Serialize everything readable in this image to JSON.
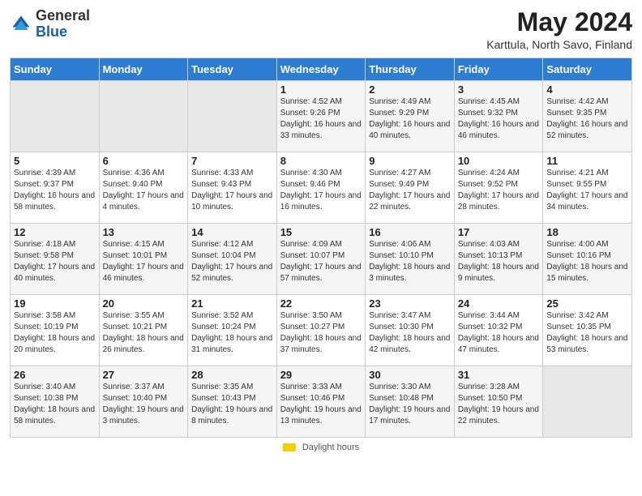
{
  "header": {
    "logo_general": "General",
    "logo_blue": "Blue",
    "month_year": "May 2024",
    "location": "Karttula, North Savo, Finland"
  },
  "weekdays": [
    "Sunday",
    "Monday",
    "Tuesday",
    "Wednesday",
    "Thursday",
    "Friday",
    "Saturday"
  ],
  "weeks": [
    [
      {
        "day": "",
        "info": ""
      },
      {
        "day": "",
        "info": ""
      },
      {
        "day": "",
        "info": ""
      },
      {
        "day": "1",
        "info": "Sunrise: 4:52 AM\nSunset: 9:26 PM\nDaylight: 16 hours\nand 33 minutes."
      },
      {
        "day": "2",
        "info": "Sunrise: 4:49 AM\nSunset: 9:29 PM\nDaylight: 16 hours\nand 40 minutes."
      },
      {
        "day": "3",
        "info": "Sunrise: 4:45 AM\nSunset: 9:32 PM\nDaylight: 16 hours\nand 46 minutes."
      },
      {
        "day": "4",
        "info": "Sunrise: 4:42 AM\nSunset: 9:35 PM\nDaylight: 16 hours\nand 52 minutes."
      }
    ],
    [
      {
        "day": "5",
        "info": "Sunrise: 4:39 AM\nSunset: 9:37 PM\nDaylight: 16 hours\nand 58 minutes."
      },
      {
        "day": "6",
        "info": "Sunrise: 4:36 AM\nSunset: 9:40 PM\nDaylight: 17 hours\nand 4 minutes."
      },
      {
        "day": "7",
        "info": "Sunrise: 4:33 AM\nSunset: 9:43 PM\nDaylight: 17 hours\nand 10 minutes."
      },
      {
        "day": "8",
        "info": "Sunrise: 4:30 AM\nSunset: 9:46 PM\nDaylight: 17 hours\nand 16 minutes."
      },
      {
        "day": "9",
        "info": "Sunrise: 4:27 AM\nSunset: 9:49 PM\nDaylight: 17 hours\nand 22 minutes."
      },
      {
        "day": "10",
        "info": "Sunrise: 4:24 AM\nSunset: 9:52 PM\nDaylight: 17 hours\nand 28 minutes."
      },
      {
        "day": "11",
        "info": "Sunrise: 4:21 AM\nSunset: 9:55 PM\nDaylight: 17 hours\nand 34 minutes."
      }
    ],
    [
      {
        "day": "12",
        "info": "Sunrise: 4:18 AM\nSunset: 9:58 PM\nDaylight: 17 hours\nand 40 minutes."
      },
      {
        "day": "13",
        "info": "Sunrise: 4:15 AM\nSunset: 10:01 PM\nDaylight: 17 hours\nand 46 minutes."
      },
      {
        "day": "14",
        "info": "Sunrise: 4:12 AM\nSunset: 10:04 PM\nDaylight: 17 hours\nand 52 minutes."
      },
      {
        "day": "15",
        "info": "Sunrise: 4:09 AM\nSunset: 10:07 PM\nDaylight: 17 hours\nand 57 minutes."
      },
      {
        "day": "16",
        "info": "Sunrise: 4:06 AM\nSunset: 10:10 PM\nDaylight: 18 hours\nand 3 minutes."
      },
      {
        "day": "17",
        "info": "Sunrise: 4:03 AM\nSunset: 10:13 PM\nDaylight: 18 hours\nand 9 minutes."
      },
      {
        "day": "18",
        "info": "Sunrise: 4:00 AM\nSunset: 10:16 PM\nDaylight: 18 hours\nand 15 minutes."
      }
    ],
    [
      {
        "day": "19",
        "info": "Sunrise: 3:58 AM\nSunset: 10:19 PM\nDaylight: 18 hours\nand 20 minutes."
      },
      {
        "day": "20",
        "info": "Sunrise: 3:55 AM\nSunset: 10:21 PM\nDaylight: 18 hours\nand 26 minutes."
      },
      {
        "day": "21",
        "info": "Sunrise: 3:52 AM\nSunset: 10:24 PM\nDaylight: 18 hours\nand 31 minutes."
      },
      {
        "day": "22",
        "info": "Sunrise: 3:50 AM\nSunset: 10:27 PM\nDaylight: 18 hours\nand 37 minutes."
      },
      {
        "day": "23",
        "info": "Sunrise: 3:47 AM\nSunset: 10:30 PM\nDaylight: 18 hours\nand 42 minutes."
      },
      {
        "day": "24",
        "info": "Sunrise: 3:44 AM\nSunset: 10:32 PM\nDaylight: 18 hours\nand 47 minutes."
      },
      {
        "day": "25",
        "info": "Sunrise: 3:42 AM\nSunset: 10:35 PM\nDaylight: 18 hours\nand 53 minutes."
      }
    ],
    [
      {
        "day": "26",
        "info": "Sunrise: 3:40 AM\nSunset: 10:38 PM\nDaylight: 18 hours\nand 58 minutes."
      },
      {
        "day": "27",
        "info": "Sunrise: 3:37 AM\nSunset: 10:40 PM\nDaylight: 19 hours\nand 3 minutes."
      },
      {
        "day": "28",
        "info": "Sunrise: 3:35 AM\nSunset: 10:43 PM\nDaylight: 19 hours\nand 8 minutes."
      },
      {
        "day": "29",
        "info": "Sunrise: 3:33 AM\nSunset: 10:46 PM\nDaylight: 19 hours\nand 13 minutes."
      },
      {
        "day": "30",
        "info": "Sunrise: 3:30 AM\nSunset: 10:48 PM\nDaylight: 19 hours\nand 17 minutes."
      },
      {
        "day": "31",
        "info": "Sunrise: 3:28 AM\nSunset: 10:50 PM\nDaylight: 19 hours\nand 22 minutes."
      },
      {
        "day": "",
        "info": ""
      }
    ]
  ],
  "footer": {
    "legend_label": "Daylight hours"
  }
}
